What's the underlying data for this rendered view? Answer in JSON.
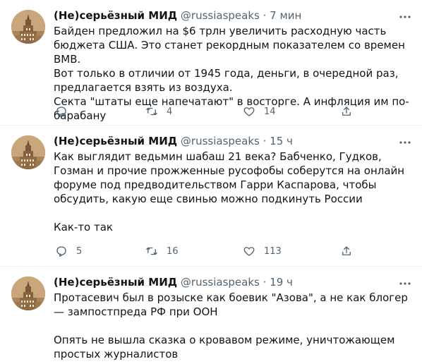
{
  "tweets": [
    {
      "name": "(Не)серьёзный МИД",
      "handle": "@russiaspeaks",
      "sep": "·",
      "time": "7 мин",
      "lines": [
        "Байден предложил на $6 трлн увеличить расходную часть бюджета США. Это станет рекордным показателем со времен ВМВ.",
        "Вот только в отличии от 1945 года, деньги, в очередной раз, предлагается взять из воздуха.",
        "Секта \"штаты еще напечатают\" в восторге. А инфляция им по-барабану"
      ],
      "replies": "",
      "retweets": "4",
      "likes": "14"
    },
    {
      "name": "(Не)серьёзный МИД",
      "handle": "@russiaspeaks",
      "sep": "·",
      "time": "15 ч",
      "lines": [
        "Как выглядит ведьмин шабаш 21 века? Бабченко, Гудков, Гозман и прочие прожженные русофобы соберутся на онлайн форуме под предводительством Гарри Каспарова, чтобы обсудить, какую еще свинью можно подкинуть России",
        "",
        "Как-то так"
      ],
      "replies": "5",
      "retweets": "16",
      "likes": "113"
    },
    {
      "name": "(Не)серьёзный МИД",
      "handle": "@russiaspeaks",
      "sep": "·",
      "time": "19 ч",
      "lines": [
        "Протасевич был в розыске как боевик \"Азова\", а не как блогер — зампостпреда РФ при ООН",
        "",
        "Опять не вышла сказка о кровавом режиме, уничтожающем простых журналистов"
      ],
      "replies": "",
      "retweets": "",
      "likes": ""
    }
  ],
  "icons": [
    "more-icon",
    "reply-icon",
    "retweet-icon",
    "like-icon",
    "share-icon"
  ],
  "colors": {
    "text": "#0f1419",
    "muted": "#536471",
    "divider": "#eff3f4"
  }
}
